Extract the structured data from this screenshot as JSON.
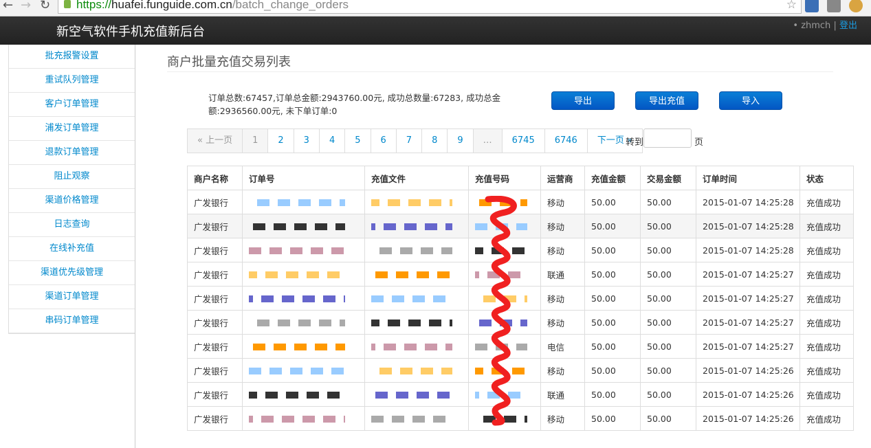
{
  "browser": {
    "url_scheme": "https://",
    "url_host": "huafei.funguide.com.cn",
    "url_path": "/batch_change_orders"
  },
  "header": {
    "brand": "新空气软件手机充值新后台",
    "user": "zhmch",
    "separator": "|",
    "logout": "登出"
  },
  "sidebar": {
    "items": [
      "批充报警设置",
      "重试队列管理",
      "客户订单管理",
      "浦发订单管理",
      "退款订单管理",
      "阻止观察",
      "渠道价格管理",
      "日志查询",
      "在线补充值",
      "渠道优先级管理",
      "渠道订单管理",
      "串码订单管理"
    ]
  },
  "page": {
    "title": "商户批量充值交易列表",
    "summary_line1": "订单总数:67457,订单总金额:2943760.00元, 成功总数量:67283, 成功总金",
    "summary_line2": "额:2936560.00元, 未下单订单:0",
    "buttons": {
      "export": "导出",
      "export_recharge": "导出充值",
      "import": "导入"
    }
  },
  "pagination": {
    "prev": "« 上一页",
    "pages": [
      "1",
      "2",
      "3",
      "4",
      "5",
      "6",
      "7",
      "8",
      "9",
      "…",
      "6745",
      "6746"
    ],
    "current": "1",
    "next": "下一页 »",
    "goto_label": "转到",
    "goto_value": "",
    "page_unit": "页"
  },
  "table": {
    "headers": [
      "商户名称",
      "订单号",
      "充值文件",
      "充值号码",
      "运营商",
      "充值金额",
      "交易金额",
      "订单时间",
      "状态"
    ],
    "rows": [
      [
        "广发银行",
        "移动",
        "50.00",
        "50.00",
        "2015-01-07 14:25:28",
        "充值成功"
      ],
      [
        "广发银行",
        "移动",
        "50.00",
        "50.00",
        "2015-01-07 14:25:28",
        "充值成功"
      ],
      [
        "广发银行",
        "移动",
        "50.00",
        "50.00",
        "2015-01-07 14:25:28",
        "充值成功"
      ],
      [
        "广发银行",
        "联通",
        "50.00",
        "50.00",
        "2015-01-07 14:25:27",
        "充值成功"
      ],
      [
        "广发银行",
        "移动",
        "50.00",
        "50.00",
        "2015-01-07 14:25:27",
        "充值成功"
      ],
      [
        "广发银行",
        "移动",
        "50.00",
        "50.00",
        "2015-01-07 14:25:27",
        "充值成功"
      ],
      [
        "广发银行",
        "电信",
        "50.00",
        "50.00",
        "2015-01-07 14:25:27",
        "充值成功"
      ],
      [
        "广发银行",
        "移动",
        "50.00",
        "50.00",
        "2015-01-07 14:25:26",
        "充值成功"
      ],
      [
        "广发银行",
        "联通",
        "50.00",
        "50.00",
        "2015-01-07 14:25:26",
        "充值成功"
      ],
      [
        "广发银行",
        "移动",
        "50.00",
        "50.00",
        "2015-01-07 14:25:26",
        "充值成功"
      ]
    ]
  }
}
